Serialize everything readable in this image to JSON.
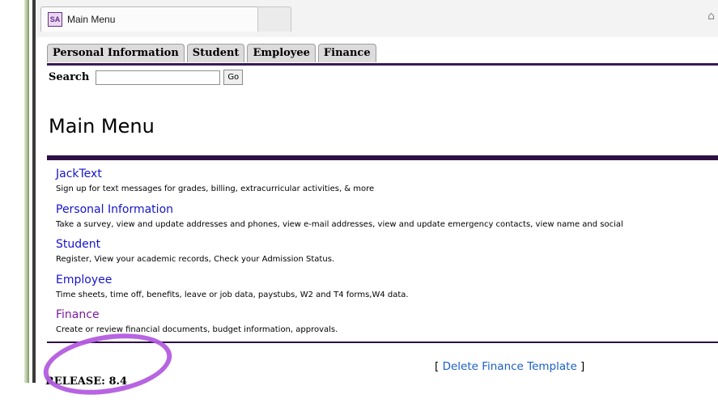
{
  "browser": {
    "tab_title": "Main Menu",
    "favicon_text": "SA"
  },
  "nav_tabs": [
    {
      "label": "Personal Information"
    },
    {
      "label": "Student"
    },
    {
      "label": "Employee"
    },
    {
      "label": "Finance"
    }
  ],
  "search": {
    "label": "Search",
    "value": "",
    "button_label": "Go"
  },
  "page_title": "Main Menu",
  "menu_items": [
    {
      "title": "JackText",
      "description": "Sign up for text messages for grades, billing, extracurricular activities, & more"
    },
    {
      "title": "Personal Information",
      "description": "Take a survey, view and update addresses and phones, view e-mail addresses, view and update emergency contacts, view name and social"
    },
    {
      "title": "Student",
      "description": "Register, View your academic records, Check your Admission Status."
    },
    {
      "title": "Employee",
      "description": "Time sheets, time off, benefits, leave or job data, paystubs, W2 and T4 forms,W4 data."
    },
    {
      "title": "Finance",
      "description": "Create or review financial documents, budget information, approvals."
    }
  ],
  "bottom_link": {
    "open_bracket": "[ ",
    "label": "Delete Finance Template",
    "close_bracket": " ]"
  },
  "release_text": "RELEASE: 8.4",
  "colors": {
    "link": "#1515c8",
    "visited_link": "#7a1aa0",
    "rule": "#2e1044",
    "highlight": "#b35ce0"
  }
}
